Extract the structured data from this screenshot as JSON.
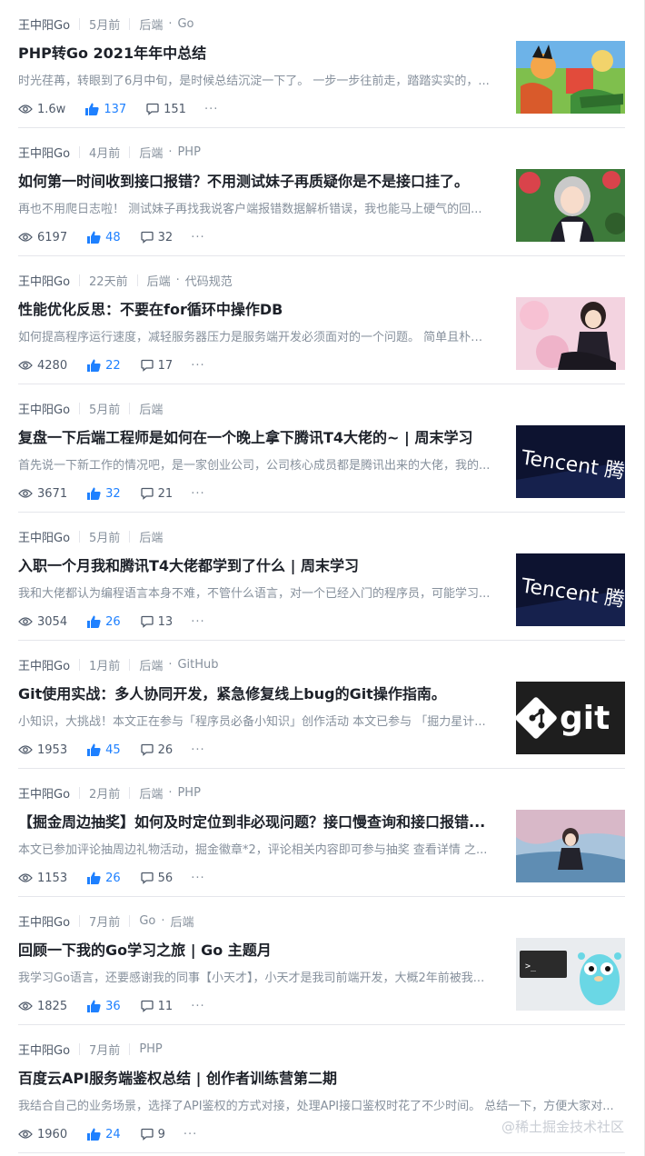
{
  "articles": [
    {
      "author": "王中阳Go",
      "time": "5月前",
      "tag1": "后端",
      "tag2": "Go",
      "title": "PHP转Go 2021年年中总结",
      "abstract": "时光荏苒，转眼到了6月中旬，是时候总结沉淀一下了。 一步一步往前走，踏踏实实的，...",
      "views": "1.6w",
      "likes": "137",
      "comments": "151",
      "thumb": "anime-adventure-scene"
    },
    {
      "author": "王中阳Go",
      "time": "4月前",
      "tag1": "后端",
      "tag2": "PHP",
      "title": "如何第一时间收到接口报错？不用测试妹子再质疑你是不是接口挂了。",
      "abstract": "再也不用爬日志啦！ 测试妹子再找我说客户端报错数据解析错误，我也能马上硬气的回...",
      "views": "6197",
      "likes": "48",
      "comments": "32",
      "thumb": "anime-maid-girl"
    },
    {
      "author": "王中阳Go",
      "time": "22天前",
      "tag1": "后端",
      "tag2": "代码规范",
      "title": "性能优化反思：不要在for循环中操作DB",
      "abstract": "如何提高程序运行速度，减轻服务器压力是服务端开发必须面对的一个问题。 简单且朴素...",
      "views": "4280",
      "likes": "22",
      "comments": "17",
      "thumb": "anime-girl-sakura"
    },
    {
      "author": "王中阳Go",
      "time": "5月前",
      "tag1": "后端",
      "tag2": "",
      "title": "复盘一下后端工程师是如何在一个晚上拿下腾讯T4大佬的~ | 周末学习",
      "abstract": "首先说一下新工作的情况吧，是一家创业公司，公司核心成员都是腾讯出来的大佬，我的...",
      "views": "3671",
      "likes": "32",
      "comments": "21",
      "thumb": "tencent-logo",
      "thumb_text": "Tencent 腾讯"
    },
    {
      "author": "王中阳Go",
      "time": "5月前",
      "tag1": "后端",
      "tag2": "",
      "title": "入职一个月我和腾讯T4大佬都学到了什么 | 周末学习",
      "abstract": "我和大佬都认为编程语言本身不难，不管什么语言，对一个已经入门的程序员，可能学习...",
      "views": "3054",
      "likes": "26",
      "comments": "13",
      "thumb": "tencent-logo",
      "thumb_text": "Tencent 腾讯"
    },
    {
      "author": "王中阳Go",
      "time": "1月前",
      "tag1": "后端",
      "tag2": "GitHub",
      "title": "Git使用实战：多人协同开发，紧急修复线上bug的Git操作指南。",
      "abstract": "小知识，大挑战！本文正在参与「程序员必备小知识」创作活动 本文已参与 「掘力星计...",
      "views": "1953",
      "likes": "45",
      "comments": "26",
      "thumb": "git-logo",
      "thumb_text": "git"
    },
    {
      "author": "王中阳Go",
      "time": "2月前",
      "tag1": "后端",
      "tag2": "PHP",
      "title": "【掘金周边抽奖】如何及时定位到非必现问题？接口慢查询和接口报错...",
      "abstract": "本文已参加评论抽周边礼物活动，掘金徽章*2，评论相关内容即可参与抽奖 查看详情 之...",
      "views": "1153",
      "likes": "26",
      "comments": "56",
      "thumb": "anime-girl-sky"
    },
    {
      "author": "王中阳Go",
      "time": "7月前",
      "tag1": "Go",
      "tag2": "后端",
      "title": "回顾一下我的Go学习之旅 | Go 主题月",
      "abstract": "我学习Go语言，还要感谢我的同事【小天才】，小天才是我司前端开发，大概2年前被我...",
      "views": "1825",
      "likes": "36",
      "comments": "11",
      "thumb": "go-gopher-terminal",
      "thumb_text": ">_"
    },
    {
      "author": "王中阳Go",
      "time": "7月前",
      "tag1": "PHP",
      "tag2": "",
      "title": "百度云API服务端鉴权总结 | 创作者训练营第二期",
      "abstract": "我结合自己的业务场景，选择了API鉴权的方式对接，处理API接口鉴权时花了不少时间。 总结一下，方便大家对...",
      "views": "1960",
      "likes": "24",
      "comments": "9",
      "thumb": ""
    }
  ],
  "more_label": "···",
  "watermark": "@稀土掘金技术社区",
  "colors": {
    "accent": "#1e80ff",
    "text": "#1d2129",
    "muted": "#86909c",
    "divider": "#e5e6eb"
  }
}
